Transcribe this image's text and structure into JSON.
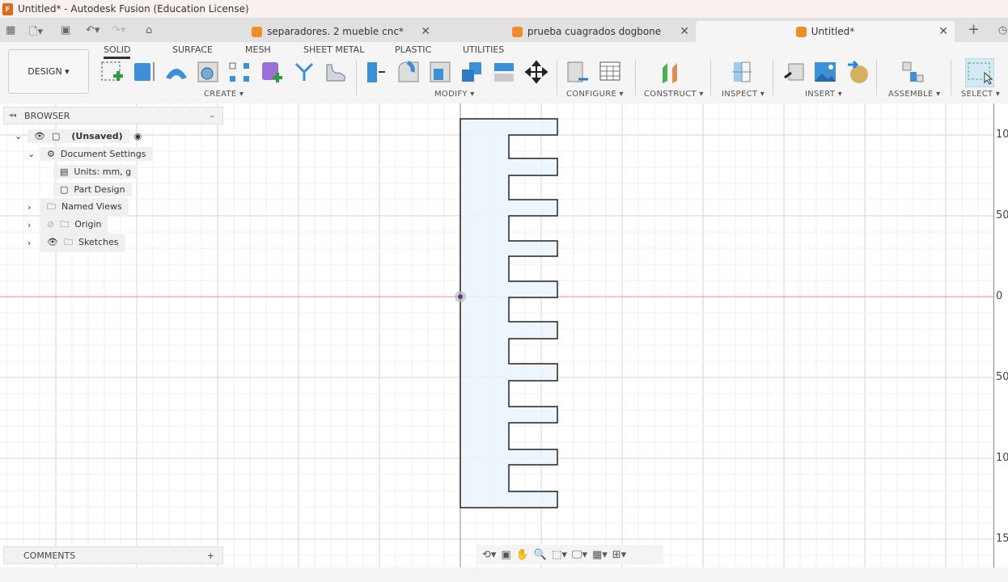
{
  "window": {
    "title": "Untitled* - Autodesk Fusion (Education License)"
  },
  "tabs": [
    {
      "label": "separadores. 2 mueble cnc*"
    },
    {
      "label": "prueba cuagrados dogbone"
    },
    {
      "label": "Untitled*",
      "active": true
    }
  ],
  "toolbar": {
    "workspace": "DESIGN ▾",
    "tabs": [
      "SOLID",
      "SURFACE",
      "MESH",
      "SHEET METAL",
      "PLASTIC",
      "UTILITIES"
    ],
    "groups": [
      "CREATE ▾",
      "MODIFY ▾",
      "CONFIGURE ▾",
      "CONSTRUCT ▾",
      "INSPECT ▾",
      "INSERT ▾",
      "ASSEMBLE ▾",
      "SELECT ▾"
    ]
  },
  "browser": {
    "title": "BROWSER",
    "root": "(Unsaved)",
    "doc_settings": "Document Settings",
    "units": "Units: mm, g",
    "part_design": "Part Design",
    "named_views": "Named Views",
    "origin": "Origin",
    "sketches": "Sketches"
  },
  "comments": {
    "title": "COMMENTS"
  },
  "ruler": {
    "labels": [
      "10",
      "50",
      "0",
      "50",
      "10",
      "15"
    ]
  },
  "colors": {
    "accent": "#0696d7",
    "sketch_fill": "#eaf5fc",
    "x_axis": "#e88",
    "y_axis": "#88a"
  }
}
